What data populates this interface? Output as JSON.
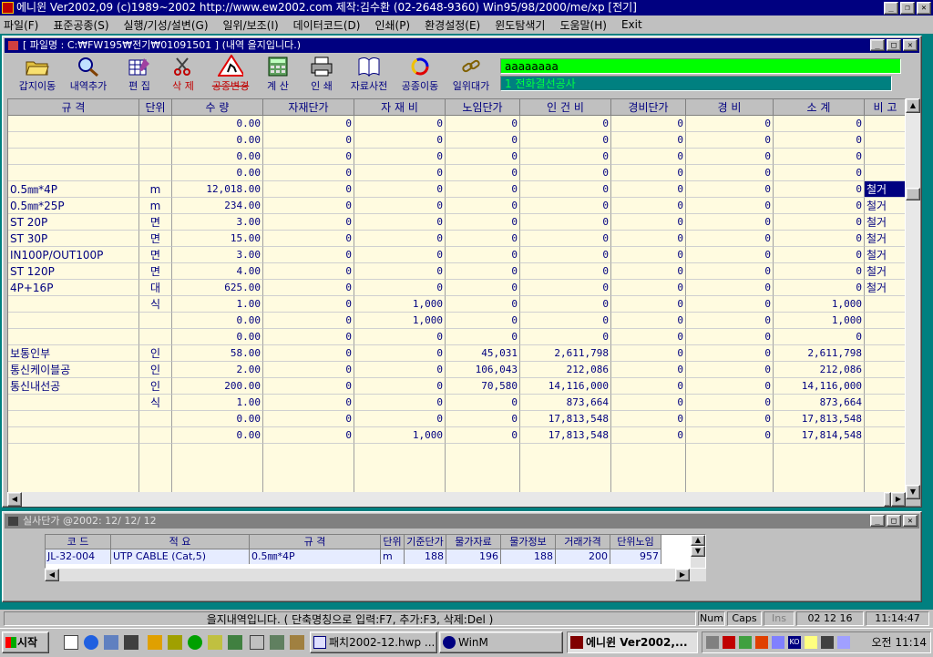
{
  "window": {
    "title": "에니윈 Ver2002,09 (c)1989~2002 http://www.ew2002.com 제작:김수환 (02-2648-9360) Win95/98/2000/me/xp [전기]"
  },
  "menu": [
    "파일(F)",
    "표준공종(S)",
    "실행/기성/설변(G)",
    "일위/보조(I)",
    "데이터코드(D)",
    "인쇄(P)",
    "환경설정(E)",
    "윈도탐색기",
    "도움말(H)",
    "Exit"
  ],
  "child": {
    "title": "[ 파일명 : C:₩FW195₩전기₩01091501 ] (내역 을지입니다.)"
  },
  "toolbar": {
    "buttons": [
      "갑지이동",
      "내역추가",
      "편 집",
      "삭 제",
      "공종변경",
      "계 산",
      "인 쇄",
      "자료사전",
      "공종이동",
      "일위대가"
    ],
    "status1": "aaaaaaaa",
    "status2": "1 전화결선공사"
  },
  "grid": {
    "headers": [
      "규    격",
      "단위",
      "수  량",
      "자재단가",
      "자 재 비",
      "노임단가",
      "인 건 비",
      "경비단가",
      "경  비",
      "소    계",
      "비  고"
    ],
    "rows": [
      [
        "",
        "",
        "0.00",
        "0",
        "0",
        "0",
        "0",
        "0",
        "0",
        "0",
        ""
      ],
      [
        "",
        "",
        "0.00",
        "0",
        "0",
        "0",
        "0",
        "0",
        "0",
        "0",
        ""
      ],
      [
        "",
        "",
        "0.00",
        "0",
        "0",
        "0",
        "0",
        "0",
        "0",
        "0",
        ""
      ],
      [
        "",
        "",
        "0.00",
        "0",
        "0",
        "0",
        "0",
        "0",
        "0",
        "0",
        ""
      ],
      [
        "0.5㎜*4P",
        "m",
        "12,018.00",
        "0",
        "0",
        "0",
        "0",
        "0",
        "0",
        "0",
        "철거"
      ],
      [
        "0.5㎜*25P",
        "m",
        "234.00",
        "0",
        "0",
        "0",
        "0",
        "0",
        "0",
        "0",
        "철거"
      ],
      [
        "ST     20P",
        "면",
        "3.00",
        "0",
        "0",
        "0",
        "0",
        "0",
        "0",
        "0",
        "철거"
      ],
      [
        "ST     30P",
        "면",
        "15.00",
        "0",
        "0",
        "0",
        "0",
        "0",
        "0",
        "0",
        "철거"
      ],
      [
        "IN100P/OUT100P",
        "면",
        "3.00",
        "0",
        "0",
        "0",
        "0",
        "0",
        "0",
        "0",
        "철거"
      ],
      [
        "ST    120P",
        "면",
        "4.00",
        "0",
        "0",
        "0",
        "0",
        "0",
        "0",
        "0",
        "철거"
      ],
      [
        "4P+16P",
        "대",
        "625.00",
        "0",
        "0",
        "0",
        "0",
        "0",
        "0",
        "0",
        "철거"
      ],
      [
        "",
        "식",
        "1.00",
        "0",
        "1,000",
        "0",
        "0",
        "0",
        "0",
        "1,000",
        ""
      ],
      [
        "",
        "",
        "0.00",
        "0",
        "1,000",
        "0",
        "0",
        "0",
        "0",
        "1,000",
        ""
      ],
      [
        "",
        "",
        "0.00",
        "0",
        "0",
        "0",
        "0",
        "0",
        "0",
        "0",
        ""
      ],
      [
        "보통인부",
        "인",
        "58.00",
        "0",
        "0",
        "45,031",
        "2,611,798",
        "0",
        "0",
        "2,611,798",
        ""
      ],
      [
        "통신케이블공",
        "인",
        "2.00",
        "0",
        "0",
        "106,043",
        "212,086",
        "0",
        "0",
        "212,086",
        ""
      ],
      [
        "통신내선공",
        "인",
        "200.00",
        "0",
        "0",
        "70,580",
        "14,116,000",
        "0",
        "0",
        "14,116,000",
        ""
      ],
      [
        "",
        "식",
        "1.00",
        "0",
        "0",
        "0",
        "873,664",
        "0",
        "0",
        "873,664",
        ""
      ],
      [
        "",
        "",
        "0.00",
        "0",
        "0",
        "0",
        "17,813,548",
        "0",
        "0",
        "17,813,548",
        ""
      ],
      [
        "",
        "",
        "0.00",
        "0",
        "1,000",
        "0",
        "17,813,548",
        "0",
        "0",
        "17,814,548",
        ""
      ]
    ]
  },
  "subwin": {
    "title": "실사단가 @2002: 12/ 12/ 12",
    "headers": [
      "코  드",
      "적    요",
      "규    격",
      "단위",
      "기준단가",
      "물가자료",
      "물가정보",
      "거래가격",
      "단위노임"
    ],
    "row": [
      "JL-32-004",
      "UTP CABLE  (Cat,5)",
      "0.5㎜*4P",
      "m",
      "188",
      "196",
      "188",
      "200",
      "957"
    ]
  },
  "statusbar": {
    "message": "을지내역입니다. ( 단축명칭으로 입력:F7,  추가:F3,  삭제:Del )",
    "num": "Num",
    "caps": "Caps",
    "ins": "Ins",
    "date": "02 12 16",
    "time": "11:14:47"
  },
  "taskbar": {
    "start": "시작",
    "tasks": [
      "패치2002-12.hwp ...",
      "WinM",
      "에니윈 Ver2002,..."
    ],
    "clock": "오전 11:14"
  }
}
